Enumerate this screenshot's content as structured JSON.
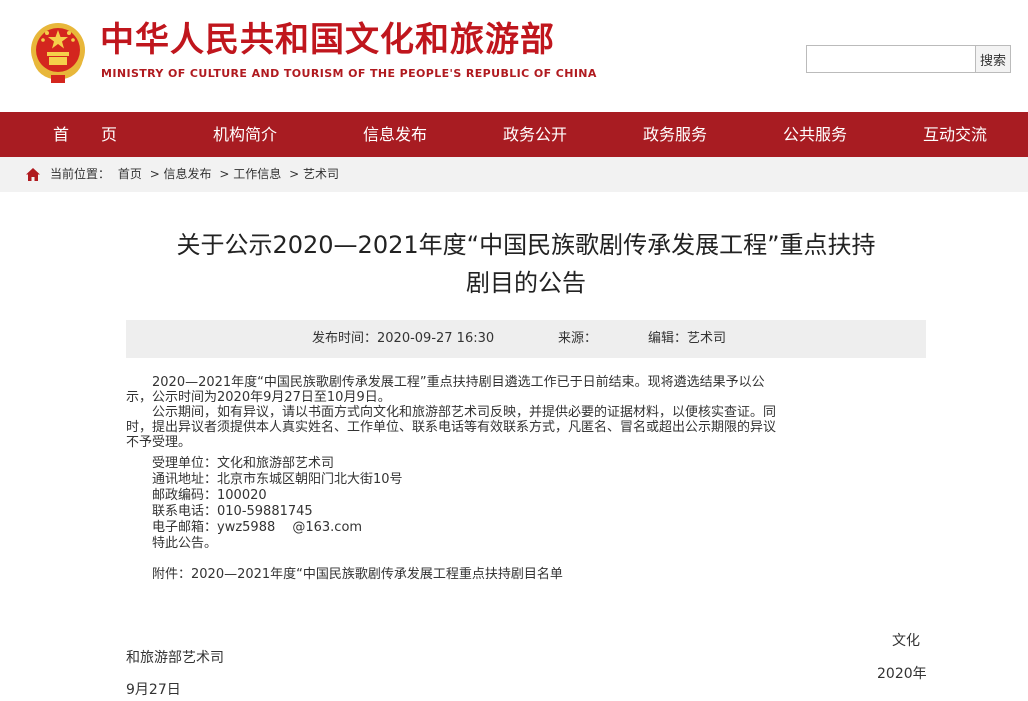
{
  "header": {
    "title": "中华人民共和国文化和旅游部",
    "subtitle": "MINISTRY OF CULTURE AND TOURISM OF THE PEOPLE'S REPUBLIC OF CHINA",
    "search_placeholder": "",
    "search_button": "搜索",
    "emblem_icon": "national-emblem-icon"
  },
  "nav": {
    "items": [
      "首　　页",
      "机构简介",
      "信息发布",
      "政务公开",
      "政务服务",
      "公共服务",
      "互动交流"
    ]
  },
  "breadcrumb": {
    "label": "当前位置：",
    "items": [
      "首页",
      "> 信息发布",
      "> 工作信息",
      "> 艺术司"
    ]
  },
  "article": {
    "title_line1": "关于公示2020—2021年度“中国民族歌剧传承发展工程”重点扶持",
    "title_line2": "剧目的公告",
    "publish_time": "发布时间：2020-09-27 16:30",
    "source": "来源：",
    "editor": "编辑：艺术司",
    "p1_line1": "　　2020—2021年度“中国民族歌剧传承发展工程”重点扶持剧目遴选工作已于日前结束。现将遴选结果予以公",
    "p1_line2": "示，公示时间为2020年9月27日至10月9日。",
    "p2_line1": "　　公示期间，如有异议，请以书面方式向文化和旅游部艺术司反映，并提供必要的证据材料，以便核实查证。同",
    "p2_line2": "时，提出异议者须提供本人真实姓名、工作单位、联系电话等有效联系方式，凡匿名、冒名或超出公示期限的异议",
    "p2_line3": "不予受理。",
    "contact_unit": "　　受理单位：文化和旅游部艺术司",
    "contact_address": "　　通讯地址：北京市东城区朝阳门北大街10号",
    "contact_zip": "　　邮政编码：100020",
    "contact_phone": "　　联系电话：010-59881745",
    "contact_email": "　　电子邮箱：ywz5988　 @163.com",
    "closing": "　　特此公告。",
    "attachment": "　　附件：2020—2021年度“中国民族歌剧传承发展工程重点扶持剧目名单",
    "sign_part1": "文化",
    "sign_part2": "和旅游部艺术司",
    "date_part1": "2020年",
    "date_part2": "9月27日"
  },
  "colors": {
    "brand_red": "#c0161d",
    "nav_red": "#a81c22",
    "meta_bg": "#eeeeee",
    "crumb_bg": "#f2f2f2"
  }
}
